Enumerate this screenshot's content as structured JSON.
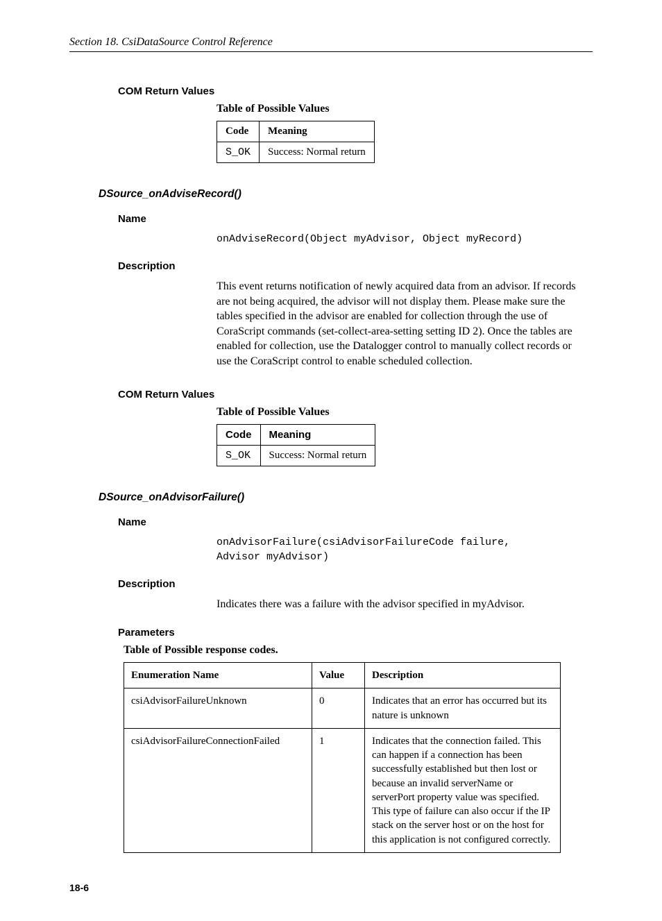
{
  "runningHead": "Section 18.  CsiDataSource Control Reference",
  "pageNumber": "18-6",
  "sec1": {
    "comHeading": "COM Return Values",
    "tableCaption": "Table of Possible Values",
    "table": {
      "h1": "Code",
      "h2": "Meaning",
      "r1c1": "S_OK",
      "r1c2": "Success: Normal return"
    }
  },
  "evt1": {
    "title": "DSource_onAdviseRecord()",
    "nameHeading": "Name",
    "signature": "onAdviseRecord(Object myAdvisor, Object myRecord)",
    "descHeading": "Description",
    "descText": "This event returns notification of newly acquired data from an advisor.  If records are not being acquired, the advisor will not display them.  Please make sure the tables specified in the advisor are enabled for collection through the use of CoraScript commands (set-collect-area-setting setting ID 2).  Once the tables are enabled for collection, use the Datalogger control to manually collect records or use the CoraScript control to enable scheduled collection.",
    "comHeading": "COM Return Values",
    "tableCaption": "Table of Possible Values",
    "table": {
      "h1": "Code",
      "h2": "Meaning",
      "r1c1": "S_OK",
      "r1c2": "Success: Normal return"
    }
  },
  "evt2": {
    "title": "DSource_onAdvisorFailure()",
    "nameHeading": "Name",
    "signature": "onAdvisorFailure(csiAdvisorFailureCode failure,\nAdvisor myAdvisor)",
    "descHeading": "Description",
    "descText": "Indicates there was a failure with the advisor specified in myAdvisor.",
    "paramsHeading": "Parameters",
    "tableCaption": "Table of Possible response codes.",
    "table": {
      "h1": "Enumeration Name",
      "h2": "Value",
      "h3": "Description",
      "r1": {
        "c1": "csiAdvisorFailureUnknown",
        "c2": "0",
        "c3": "Indicates that an error has occurred but its nature is unknown"
      },
      "r2": {
        "c1": "csiAdvisorFailureConnectionFailed",
        "c2": "1",
        "c3": "Indicates that the connection failed. This can happen if a connection has been successfully established but then lost or because an invalid serverName or serverPort property value was specified. This type of failure can also occur if the IP stack on the server host or on the host for this application is not configured correctly."
      }
    }
  }
}
